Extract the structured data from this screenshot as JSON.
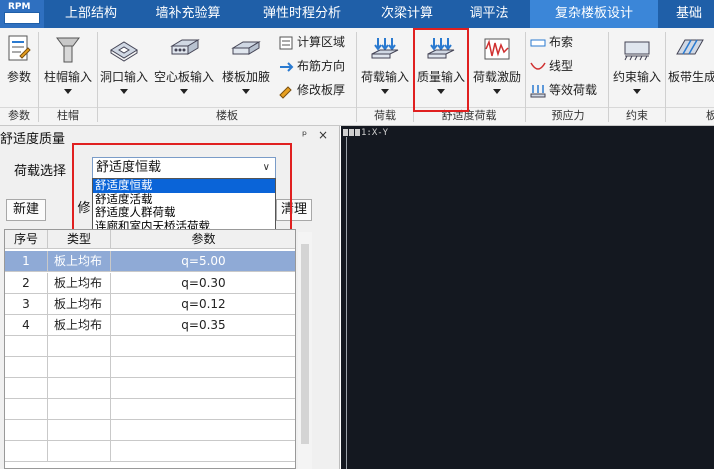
{
  "app": {
    "logo_text": "RPM"
  },
  "tabs": [
    {
      "label": "上部结构",
      "active": false
    },
    {
      "label": "墙补充验算",
      "active": false
    },
    {
      "label": "弹性时程分析",
      "active": false
    },
    {
      "label": "次梁计算",
      "active": false
    },
    {
      "label": "调平法",
      "active": false
    },
    {
      "label": "复杂楼板设计",
      "active": true
    },
    {
      "label": "基础",
      "active": false
    }
  ],
  "ribbon": {
    "params_label": "参数",
    "column_cap_label": "柱帽输入",
    "hole_label": "洞口输入",
    "hollow_slab_label": "空心板输入",
    "slab_haunch_label": "楼板加腋",
    "calc_area_label": "计算区域",
    "rebar_dir_label": "布筋方向",
    "modify_thick_label": "修改板厚",
    "load_input_label": "荷载输入",
    "mass_input_label": "质量输入",
    "load_excite_label": "荷载激励",
    "cable_label": "布索",
    "line_shape_label": "线型",
    "equiv_load_label": "等效荷载",
    "constraint_label": "约束输入",
    "strip_label": "板带生成",
    "groups": {
      "params": "参数",
      "column_cap": "柱帽",
      "slab": "楼板",
      "load": "荷载",
      "comfort_load": "舒适度荷载",
      "prestress": "预应力",
      "constraint": "约束",
      "extra": "板"
    }
  },
  "panel": {
    "title": "舒适度质量",
    "pin": "ᵖ",
    "close": "×",
    "load_select_label": "荷载选择",
    "selected_load": "舒适度恒载",
    "options": [
      "舒适度恒载",
      "舒适度活载",
      "舒适度人群荷载",
      "连廊和室内天桥活荷载"
    ],
    "new_button": "新建",
    "modify_button": "修",
    "clear_button": "清理",
    "table": {
      "headers": [
        "序号",
        "类型",
        "参数"
      ],
      "rows": [
        {
          "no": "1",
          "type": "板上均布",
          "param": "q=5.00",
          "selected": true
        },
        {
          "no": "2",
          "type": "板上均布",
          "param": "q=0.30",
          "selected": false
        },
        {
          "no": "3",
          "type": "板上均布",
          "param": "q=0.12",
          "selected": false
        },
        {
          "no": "4",
          "type": "板上均布",
          "param": "q=0.35",
          "selected": false
        }
      ]
    }
  },
  "canvas": {
    "view_label": "1:X-Y"
  },
  "colors": {
    "tab_bar": "#1f5fa8",
    "active_tab": "#3b86d8",
    "highlight": "#e02020",
    "selection": "#0a64d8",
    "canvas_bg": "#141820"
  }
}
